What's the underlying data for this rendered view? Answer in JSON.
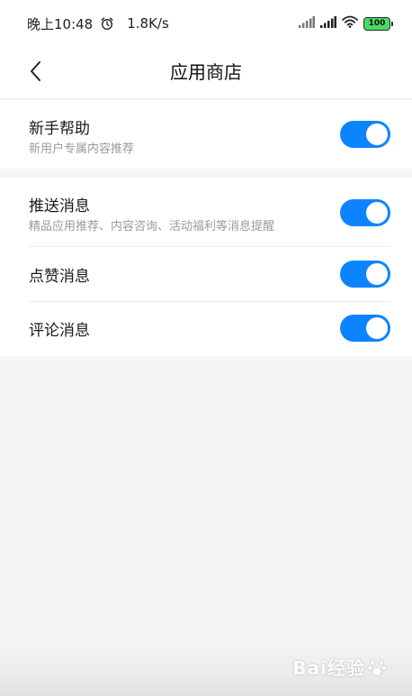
{
  "status_bar": {
    "time": "晚上10:48",
    "net_speed": "1.8K/s",
    "battery": "100",
    "icons": [
      "alarm-icon",
      "signal-icon",
      "signal-icon",
      "wifi-icon",
      "battery-icon"
    ]
  },
  "nav": {
    "title": "应用商店",
    "back_icon": "chevron-left-icon"
  },
  "settings": {
    "newbie": {
      "title": "新手帮助",
      "subtitle": "新用户专属内容推荐",
      "enabled": true
    },
    "push": {
      "title": "推送消息",
      "subtitle": "精品应用推荐、内容咨询、活动福利等消息提醒",
      "enabled": true
    },
    "likes": {
      "title": "点赞消息",
      "enabled": true
    },
    "comments": {
      "title": "评论消息",
      "enabled": true
    }
  },
  "watermark": {
    "text": "Bai经验"
  },
  "colors": {
    "accent": "#0d84ff",
    "background": "#f4f5f4",
    "card": "#ffffff",
    "subtitle": "#9a9a9a",
    "battery": "#4cd964"
  }
}
